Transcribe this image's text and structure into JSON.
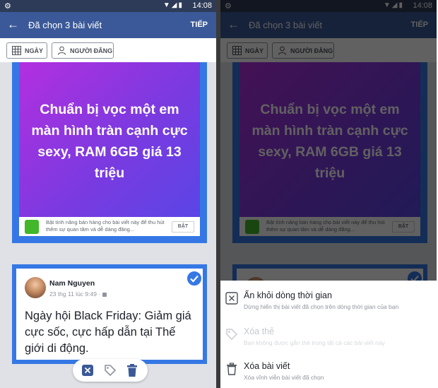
{
  "status": {
    "time": "14:08"
  },
  "header": {
    "title": "Đã chọn 3 bài viết",
    "next_label": "TIẾP"
  },
  "filters": {
    "date_label": "NGÀY",
    "poster_label": "NGƯỜI ĐĂNG"
  },
  "post1": {
    "banner_text": "Chuẩn bị vọc một em màn hình tràn cạnh cực sexy, RAM 6GB giá 13 triệu",
    "promo_text": "Bật tính năng bán hàng cho bài viết này để thu hút thêm sự quan tâm và dễ dàng đăng...",
    "promo_button": "BẬT"
  },
  "post2": {
    "author": "Nam Nguyen",
    "meta": "23 thg 11 lúc 9:49 ·",
    "body": "Ngày hội Black Friday: Giảm giá cực sốc, cực hấp dẫn tại Thế giới di động.",
    "selected": true
  },
  "sheet": {
    "items": [
      {
        "title": "Ẩn khỏi dòng thời gian",
        "subtitle": "Dừng hiển thị bài viết đã chọn trên dòng thời gian của bạn",
        "icon": "hide-box-icon",
        "enabled": true
      },
      {
        "title": "Xóa thẻ",
        "subtitle": "Bạn không được gắn thẻ trong tất cả các bài viết này",
        "icon": "tag-icon",
        "enabled": false
      },
      {
        "title": "Xóa bài viết",
        "subtitle": "Xóa vĩnh viễn bài viết đã chọn",
        "icon": "trash-icon",
        "enabled": true
      }
    ]
  },
  "colors": {
    "brand": "#3b5998",
    "statusbar": "#2d3b58",
    "selection": "#3578e5",
    "banner_start": "#b32fe0",
    "banner_end": "#5a45e6",
    "promo_green": "#42b72a"
  }
}
